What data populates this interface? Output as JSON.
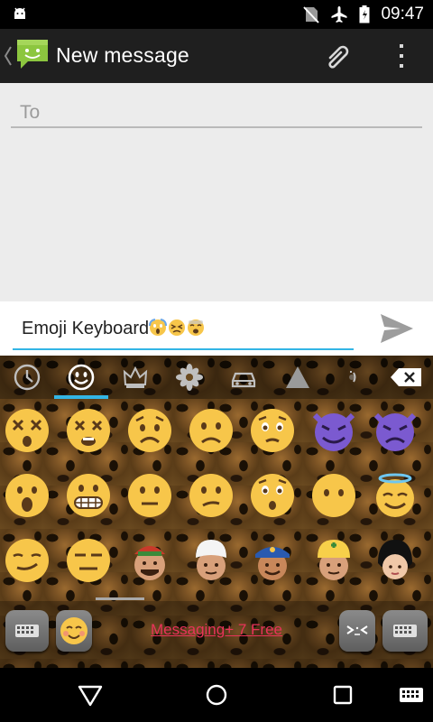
{
  "status_bar": {
    "time": "09:47",
    "icons": [
      "android-debug-icon",
      "no-sim-icon",
      "airplane-icon",
      "battery-icon"
    ]
  },
  "action_bar": {
    "title": "New message",
    "icons": [
      "back-chevron-icon",
      "messaging-app-icon",
      "attach-icon",
      "overflow-menu-icon"
    ]
  },
  "recipient": {
    "placeholder": "To"
  },
  "compose": {
    "text": "Emoji Keyboard",
    "inline_emojis": [
      "screaming-face",
      "persevering-face",
      "weary-face"
    ],
    "send_icon": "send-icon"
  },
  "keyboard": {
    "categories": [
      "recent",
      "faces",
      "crown",
      "flower",
      "car",
      "triangle",
      "emoticon"
    ],
    "selected_category": "faces",
    "emoji_rows": [
      [
        "dizzy-face",
        "dizzy-face-2",
        "worried-face",
        "frowning-face",
        "hushed-face",
        "smiling-imp",
        "angry-imp"
      ],
      [
        "open-mouth-face",
        "grimacing-face",
        "neutral-face",
        "confused-face",
        "astonished-face",
        "no-mouth-face",
        "halo-face"
      ],
      [
        "smirking-face",
        "expressionless-face",
        "man-with-hat",
        "man-with-turban",
        "police-officer",
        "construction-worker",
        "woman-black-hair"
      ]
    ],
    "bottom_bar": {
      "promo_text": "Messaging+ 7 Free",
      "keys": [
        "keyboard-switch-key",
        "emoji-key",
        "emoticon-key",
        "keyboard-key"
      ]
    }
  },
  "nav_bar": {
    "icons": [
      "back-icon",
      "home-icon",
      "recents-icon",
      "keyboard-icon"
    ]
  },
  "colors": {
    "accent": "#33b5e5",
    "promo": "#e8335a",
    "emoji_yellow": "#f7c64a",
    "imp_purple": "#7b5ad0"
  }
}
